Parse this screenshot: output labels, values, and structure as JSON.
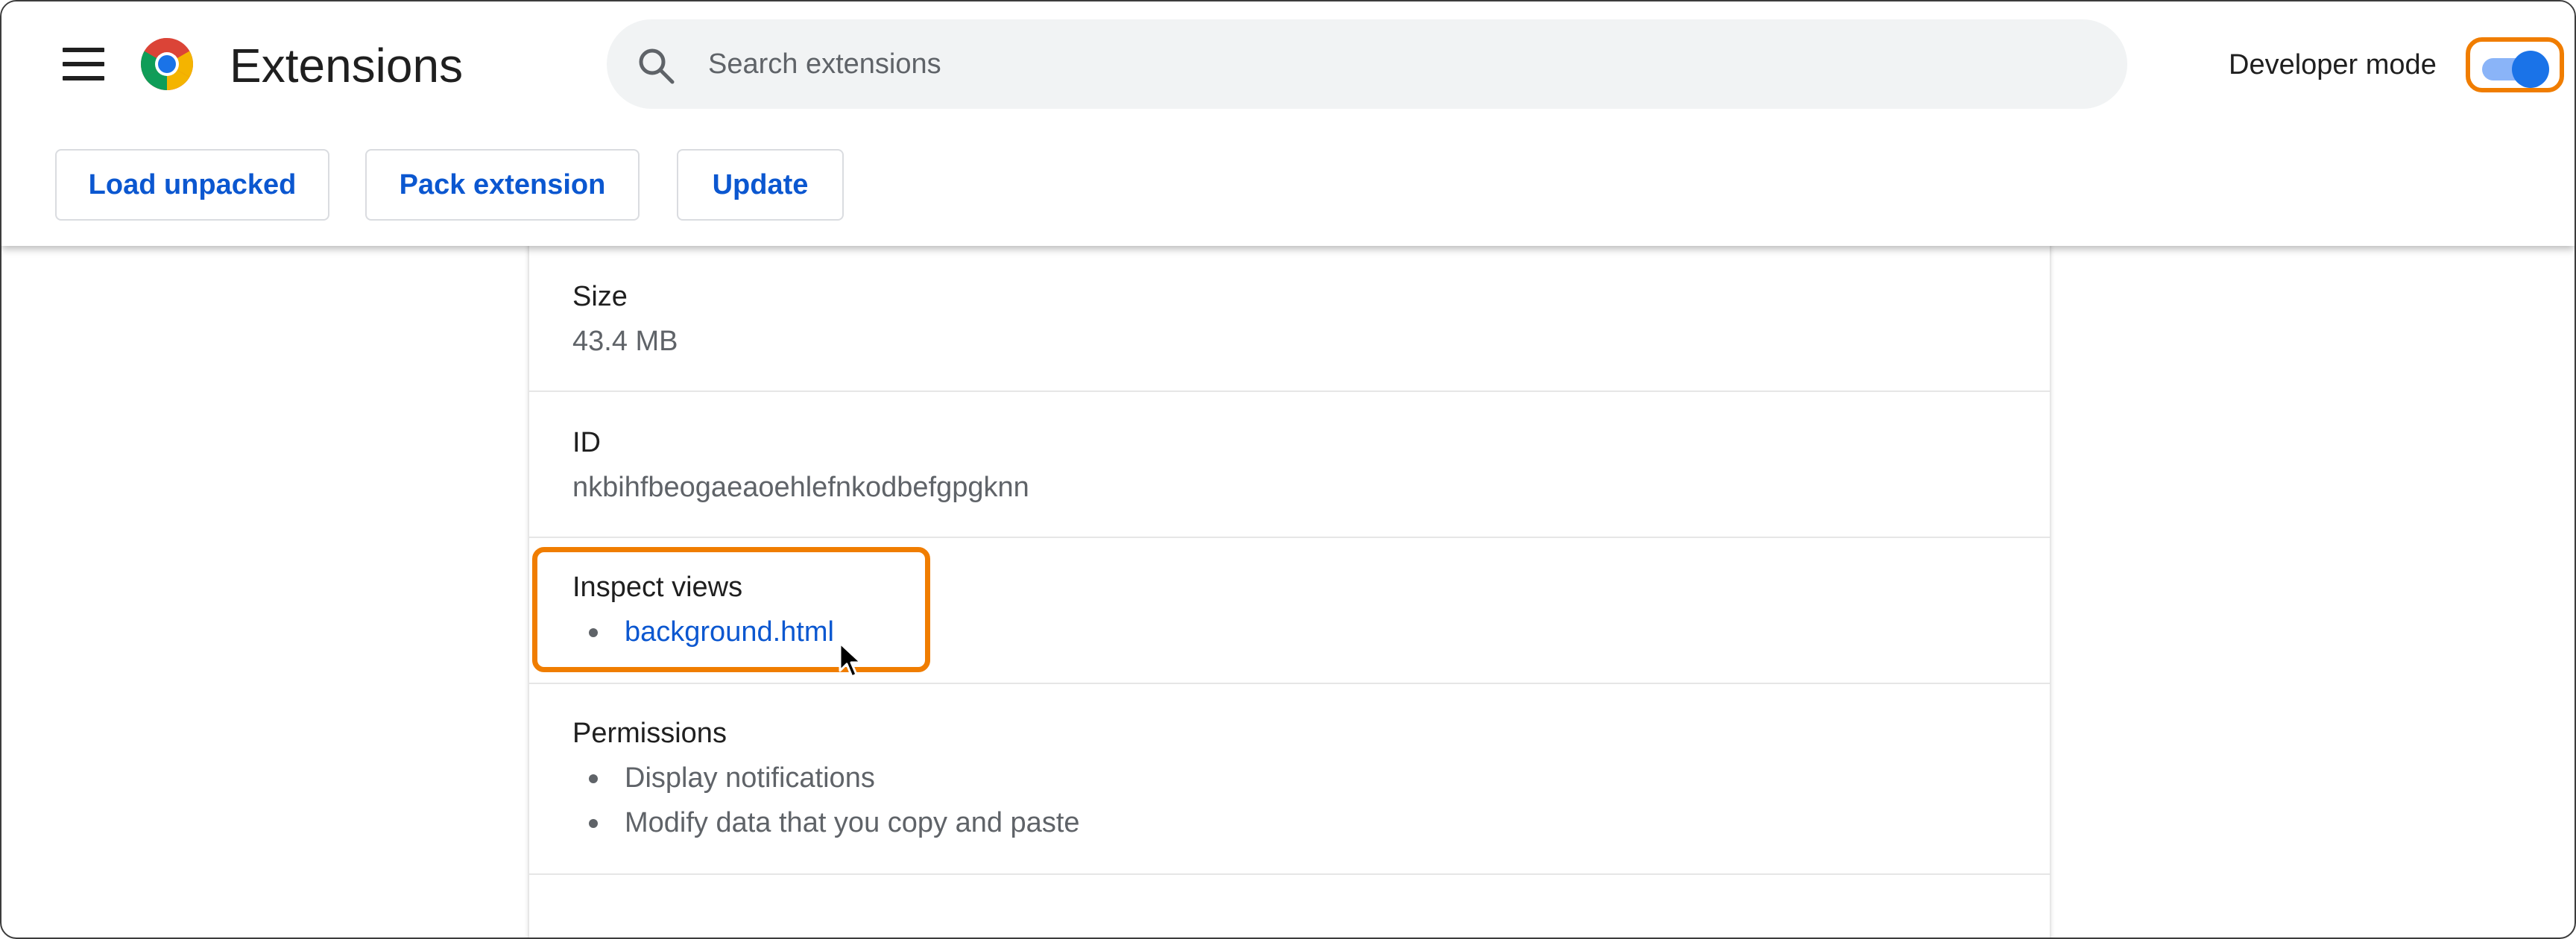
{
  "header": {
    "title": "Extensions",
    "search_placeholder": "Search extensions",
    "developer_mode_label": "Developer mode",
    "developer_mode_on": true
  },
  "toolbar": {
    "load_unpacked": "Load unpacked",
    "pack_extension": "Pack extension",
    "update": "Update"
  },
  "details": {
    "size": {
      "label": "Size",
      "value": "43.4 MB"
    },
    "id": {
      "label": "ID",
      "value": "nkbihfbeogaeaoehlefnkodbefgpgknn"
    },
    "inspect_views": {
      "label": "Inspect views",
      "items": [
        "background.html"
      ]
    },
    "permissions": {
      "label": "Permissions",
      "items": [
        "Display notifications",
        "Modify data that you copy and paste"
      ]
    }
  },
  "colors": {
    "accent": "#0b57d0",
    "toggle_on": "#1a73e8",
    "highlight": "#f07d00"
  },
  "icons": [
    "menu-icon",
    "chrome-logo-icon",
    "search-icon",
    "mouse-cursor-icon"
  ]
}
